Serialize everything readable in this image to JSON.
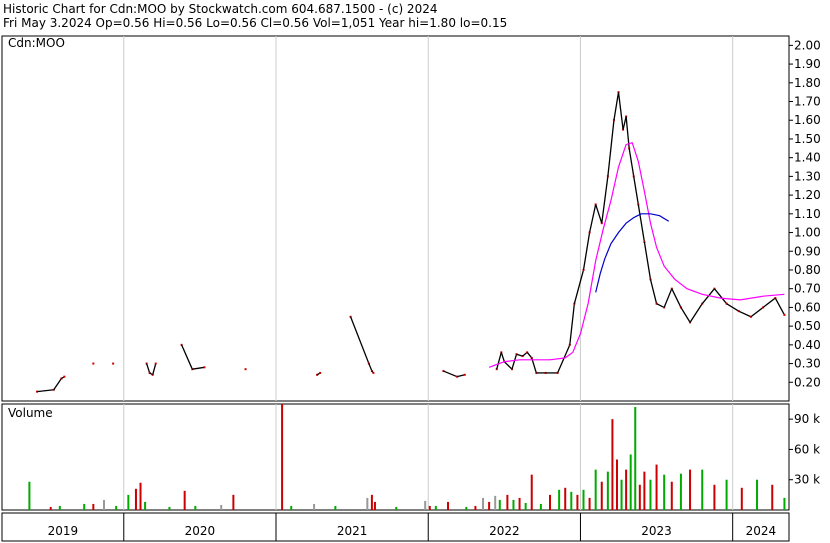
{
  "header": {
    "line1": "Historic Chart for Cdn:MOO by Stockwatch.com 604.687.1500 - (c) 2024",
    "line2": "Fri May  3.2024   Op=0.56  Hi=0.56  Lo=0.56  Cl=0.56  Vol=1,051  Year hi=1.80  lo=0.15"
  },
  "chart_data": {
    "type": "line",
    "symbol": "Cdn:MOO",
    "price_axis": {
      "ticks": [
        "2.00",
        "1.90",
        "1.80",
        "1.70",
        "1.60",
        "1.50",
        "1.40",
        "1.30",
        "1.20",
        "1.10",
        "1.00",
        "0.90",
        "0.80",
        "0.70",
        "0.60",
        "0.50",
        "0.40",
        "0.30",
        "0.20"
      ],
      "ylim": [
        0.1,
        2.05
      ]
    },
    "volume_axis": {
      "label": "Volume",
      "ticks": [
        "90 k",
        "60 k",
        "30 k"
      ],
      "ylim": [
        0,
        105000
      ]
    },
    "x_axis": {
      "years": [
        "2019",
        "2020",
        "2021",
        "2022",
        "2023",
        "2024"
      ],
      "xlim": [
        2019.2,
        2024.37
      ]
    },
    "series": [
      {
        "kind": "price",
        "color": "#cc0000",
        "points": [
          [
            2019.43,
            0.15
          ],
          [
            2019.54,
            0.16
          ],
          [
            2019.59,
            0.22
          ],
          [
            2019.61,
            0.23
          ],
          [
            2019.8,
            0.3
          ],
          [
            2019.93,
            0.3
          ],
          [
            2020.15,
            0.3
          ],
          [
            2020.17,
            0.25
          ],
          [
            2020.19,
            0.24
          ],
          [
            2020.21,
            0.3
          ],
          [
            2020.38,
            0.4
          ],
          [
            2020.45,
            0.27
          ],
          [
            2020.53,
            0.28
          ],
          [
            2020.8,
            0.27
          ],
          [
            2021.27,
            0.24
          ],
          [
            2021.29,
            0.25
          ],
          [
            2021.49,
            0.55
          ],
          [
            2021.61,
            0.3
          ],
          [
            2021.63,
            0.26
          ],
          [
            2021.64,
            0.25
          ],
          [
            2022.1,
            0.26
          ],
          [
            2022.19,
            0.23
          ],
          [
            2022.24,
            0.24
          ],
          [
            2022.45,
            0.27
          ],
          [
            2022.48,
            0.36
          ],
          [
            2022.5,
            0.31
          ],
          [
            2022.55,
            0.27
          ],
          [
            2022.58,
            0.35
          ],
          [
            2022.62,
            0.34
          ],
          [
            2022.65,
            0.36
          ],
          [
            2022.68,
            0.33
          ],
          [
            2022.71,
            0.25
          ],
          [
            2022.77,
            0.25
          ],
          [
            2022.85,
            0.25
          ],
          [
            2022.93,
            0.4
          ],
          [
            2022.96,
            0.62
          ],
          [
            2023.02,
            0.8
          ],
          [
            2023.06,
            1.0
          ],
          [
            2023.1,
            1.15
          ],
          [
            2023.14,
            1.05
          ],
          [
            2023.18,
            1.3
          ],
          [
            2023.22,
            1.6
          ],
          [
            2023.25,
            1.75
          ],
          [
            2023.28,
            1.55
          ],
          [
            2023.3,
            1.62
          ],
          [
            2023.32,
            1.45
          ],
          [
            2023.35,
            1.3
          ],
          [
            2023.38,
            1.15
          ],
          [
            2023.42,
            0.95
          ],
          [
            2023.46,
            0.75
          ],
          [
            2023.5,
            0.62
          ],
          [
            2023.55,
            0.6
          ],
          [
            2023.6,
            0.7
          ],
          [
            2023.66,
            0.6
          ],
          [
            2023.72,
            0.52
          ],
          [
            2023.8,
            0.62
          ],
          [
            2023.88,
            0.7
          ],
          [
            2023.96,
            0.62
          ],
          [
            2024.04,
            0.58
          ],
          [
            2024.12,
            0.55
          ],
          [
            2024.2,
            0.6
          ],
          [
            2024.28,
            0.65
          ],
          [
            2024.34,
            0.56
          ]
        ]
      },
      {
        "kind": "moving-average-short",
        "color": "#ff00ff",
        "points": [
          [
            2022.4,
            0.28
          ],
          [
            2022.5,
            0.31
          ],
          [
            2022.6,
            0.32
          ],
          [
            2022.7,
            0.32
          ],
          [
            2022.8,
            0.32
          ],
          [
            2022.9,
            0.33
          ],
          [
            2022.95,
            0.36
          ],
          [
            2023.0,
            0.46
          ],
          [
            2023.05,
            0.62
          ],
          [
            2023.1,
            0.85
          ],
          [
            2023.15,
            1.02
          ],
          [
            2023.2,
            1.17
          ],
          [
            2023.25,
            1.35
          ],
          [
            2023.3,
            1.47
          ],
          [
            2023.34,
            1.48
          ],
          [
            2023.38,
            1.38
          ],
          [
            2023.42,
            1.22
          ],
          [
            2023.46,
            1.05
          ],
          [
            2023.5,
            0.92
          ],
          [
            2023.55,
            0.82
          ],
          [
            2023.62,
            0.75
          ],
          [
            2023.7,
            0.7
          ],
          [
            2023.8,
            0.67
          ],
          [
            2023.92,
            0.65
          ],
          [
            2024.05,
            0.64
          ],
          [
            2024.2,
            0.66
          ],
          [
            2024.34,
            0.67
          ]
        ]
      },
      {
        "kind": "moving-average-long",
        "color": "#0000cc",
        "points": [
          [
            2023.1,
            0.68
          ],
          [
            2023.13,
            0.78
          ],
          [
            2023.16,
            0.86
          ],
          [
            2023.2,
            0.94
          ],
          [
            2023.25,
            1.0
          ],
          [
            2023.3,
            1.05
          ],
          [
            2023.35,
            1.08
          ],
          [
            2023.4,
            1.1
          ],
          [
            2023.46,
            1.1
          ],
          [
            2023.52,
            1.09
          ],
          [
            2023.58,
            1.06
          ]
        ]
      },
      {
        "kind": "volume",
        "points": [
          [
            2019.38,
            28000,
            "#00aa00"
          ],
          [
            2019.52,
            3000,
            "#cc0000"
          ],
          [
            2019.58,
            4000,
            "#00aa00"
          ],
          [
            2019.74,
            6000,
            "#00aa00"
          ],
          [
            2019.8,
            6000,
            "#cc0000"
          ],
          [
            2019.87,
            10000,
            "#999999"
          ],
          [
            2019.95,
            4000,
            "#00aa00"
          ],
          [
            2020.03,
            15000,
            "#00aa00"
          ],
          [
            2020.08,
            21000,
            "#cc0000"
          ],
          [
            2020.11,
            27000,
            "#cc0000"
          ],
          [
            2020.14,
            8000,
            "#00aa00"
          ],
          [
            2020.3,
            3000,
            "#00aa00"
          ],
          [
            2020.4,
            19000,
            "#cc0000"
          ],
          [
            2020.47,
            4000,
            "#00aa00"
          ],
          [
            2020.64,
            5000,
            "#999999"
          ],
          [
            2020.72,
            15000,
            "#cc0000"
          ],
          [
            2021.04,
            105000,
            "#cc0000"
          ],
          [
            2021.1,
            4000,
            "#00aa00"
          ],
          [
            2021.25,
            6000,
            "#999999"
          ],
          [
            2021.39,
            4000,
            "#00aa00"
          ],
          [
            2021.6,
            12000,
            "#999999"
          ],
          [
            2021.63,
            15000,
            "#cc0000"
          ],
          [
            2021.65,
            8000,
            "#cc0000"
          ],
          [
            2021.79,
            3000,
            "#00aa00"
          ],
          [
            2021.98,
            9000,
            "#999999"
          ],
          [
            2022.01,
            4000,
            "#cc0000"
          ],
          [
            2022.05,
            4000,
            "#00aa00"
          ],
          [
            2022.13,
            8000,
            "#cc0000"
          ],
          [
            2022.25,
            3000,
            "#00aa00"
          ],
          [
            2022.31,
            4000,
            "#cc0000"
          ],
          [
            2022.36,
            12000,
            "#999999"
          ],
          [
            2022.4,
            8000,
            "#cc0000"
          ],
          [
            2022.44,
            14000,
            "#999999"
          ],
          [
            2022.47,
            10000,
            "#00aa00"
          ],
          [
            2022.52,
            15000,
            "#cc0000"
          ],
          [
            2022.56,
            10000,
            "#00aa00"
          ],
          [
            2022.6,
            12000,
            "#cc0000"
          ],
          [
            2022.64,
            7000,
            "#00aa00"
          ],
          [
            2022.68,
            35000,
            "#cc0000"
          ],
          [
            2022.74,
            6000,
            "#00aa00"
          ],
          [
            2022.8,
            15000,
            "#cc0000"
          ],
          [
            2022.86,
            20000,
            "#00aa00"
          ],
          [
            2022.9,
            22000,
            "#cc0000"
          ],
          [
            2022.94,
            18000,
            "#00aa00"
          ],
          [
            2022.98,
            15000,
            "#cc0000"
          ],
          [
            2023.02,
            20000,
            "#00aa00"
          ],
          [
            2023.06,
            12000,
            "#cc0000"
          ],
          [
            2023.1,
            40000,
            "#00aa00"
          ],
          [
            2023.14,
            28000,
            "#cc0000"
          ],
          [
            2023.18,
            38000,
            "#00aa00"
          ],
          [
            2023.21,
            90000,
            "#cc0000"
          ],
          [
            2023.24,
            50000,
            "#cc0000"
          ],
          [
            2023.27,
            30000,
            "#00aa00"
          ],
          [
            2023.3,
            40000,
            "#cc0000"
          ],
          [
            2023.33,
            55000,
            "#00aa00"
          ],
          [
            2023.36,
            102000,
            "#00aa00"
          ],
          [
            2023.39,
            25000,
            "#cc0000"
          ],
          [
            2023.42,
            38000,
            "#cc0000"
          ],
          [
            2023.46,
            30000,
            "#00aa00"
          ],
          [
            2023.5,
            45000,
            "#cc0000"
          ],
          [
            2023.55,
            35000,
            "#00aa00"
          ],
          [
            2023.6,
            28000,
            "#cc0000"
          ],
          [
            2023.66,
            36000,
            "#00aa00"
          ],
          [
            2023.72,
            40000,
            "#cc0000"
          ],
          [
            2023.8,
            40000,
            "#00aa00"
          ],
          [
            2023.88,
            25000,
            "#cc0000"
          ],
          [
            2023.96,
            30000,
            "#00aa00"
          ],
          [
            2024.06,
            22000,
            "#cc0000"
          ],
          [
            2024.16,
            30000,
            "#00aa00"
          ],
          [
            2024.26,
            25000,
            "#cc0000"
          ],
          [
            2024.34,
            12000,
            "#00aa00"
          ]
        ]
      }
    ],
    "grid": true
  }
}
